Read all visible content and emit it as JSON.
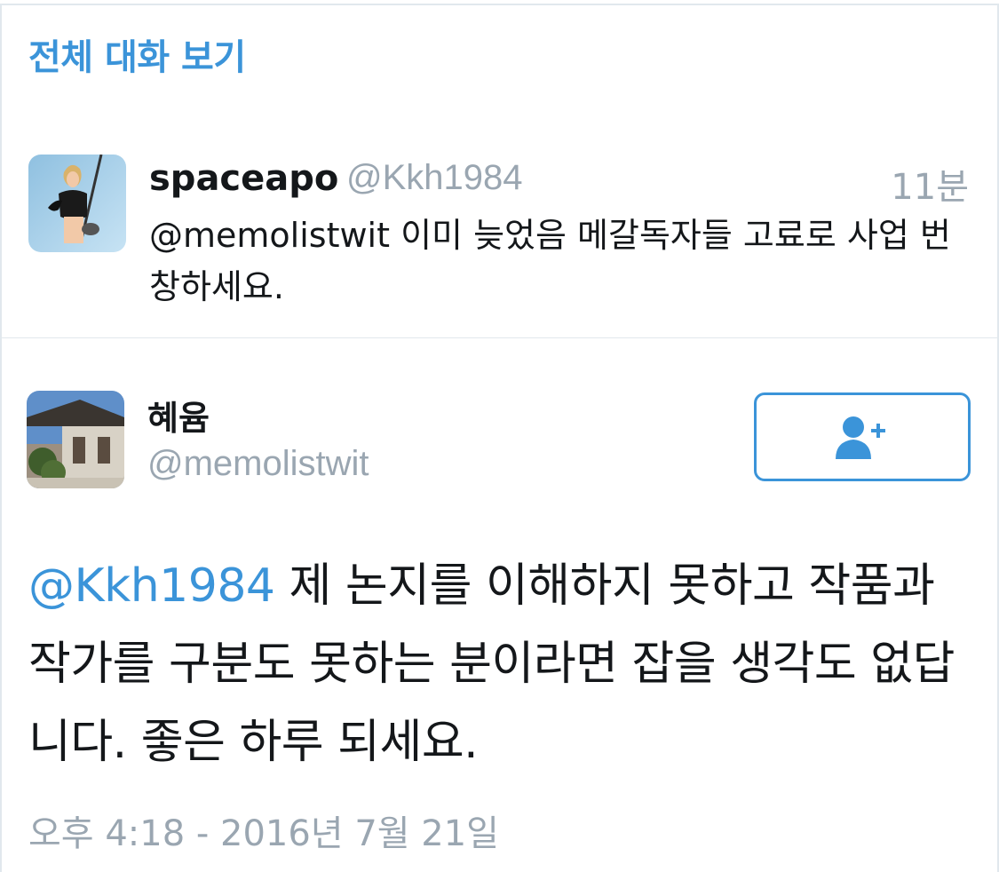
{
  "header": {
    "conversation_link": "전체 대화 보기"
  },
  "reply_tweet": {
    "display_name": "spaceapo",
    "handle": "@Kkh1984",
    "time": "11분",
    "text": "@memolistwit 이미 늦었음 메갈독자들 고료로 사업 번창하세요."
  },
  "main_tweet": {
    "display_name": "혜윰",
    "handle": "@memolistwit",
    "follow_icon": "add-user-icon",
    "mention": "@Kkh1984",
    "text": " 제 논지를 이해하지 못하고 작품과 작가를 구분도 못하는 분이라면 잡을 생각도 없답니다. 좋은 하루 되세요.",
    "timestamp": "오후 4:18 - 2016년 7월 21일"
  },
  "colors": {
    "accent": "#3b94d9",
    "muted": "#9aa6b1",
    "text": "#14171a",
    "border": "#e1e8ed"
  }
}
